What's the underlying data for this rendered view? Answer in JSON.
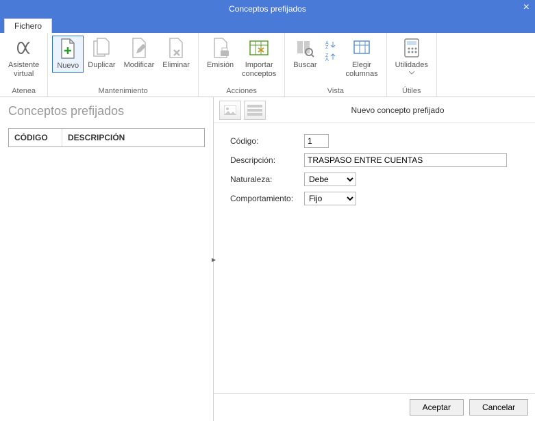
{
  "window": {
    "title": "Conceptos prefijados"
  },
  "tabs": {
    "file": "Fichero"
  },
  "ribbon": {
    "atenea": {
      "label": "Asistente\nvirtual",
      "group": "Atenea"
    },
    "maintenance": {
      "group": "Mantenimiento",
      "new": "Nuevo",
      "duplicate": "Duplicar",
      "modify": "Modificar",
      "delete": "Eliminar"
    },
    "actions": {
      "group": "Acciones",
      "emit": "Emisión",
      "import": "Importar\nconceptos"
    },
    "view": {
      "group": "Vista",
      "search": "Buscar",
      "columns": "Elegir\ncolumnas"
    },
    "utils": {
      "group": "Útiles",
      "utilities": "Utilidades"
    }
  },
  "left": {
    "heading": "Conceptos prefijados",
    "col_code": "CÓDIGO",
    "col_desc": "DESCRIPCIÓN"
  },
  "right": {
    "title": "Nuevo concepto prefijado",
    "labels": {
      "code": "Código:",
      "desc": "Descripción:",
      "nature": "Naturaleza:",
      "behavior": "Comportamiento:"
    },
    "values": {
      "code": "1",
      "desc": "TRASPASO ENTRE CUENTAS",
      "nature": "Debe",
      "behavior": "Fijo"
    }
  },
  "footer": {
    "accept": "Aceptar",
    "cancel": "Cancelar"
  }
}
